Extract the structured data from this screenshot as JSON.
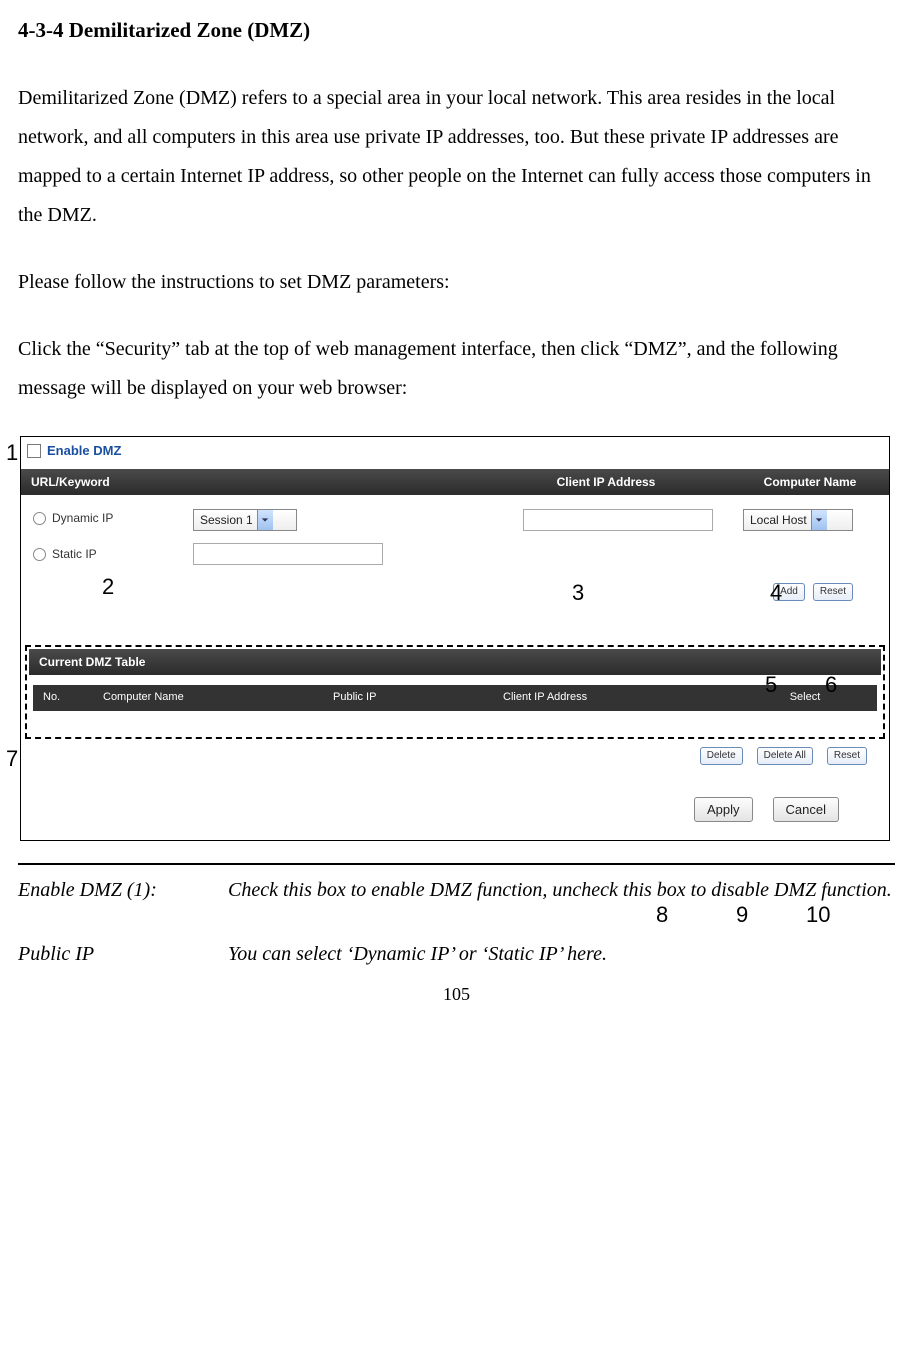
{
  "heading": "4-3-4 Demilitarized Zone (DMZ)",
  "para1": "Demilitarized Zone (DMZ) refers to a special area in your local network. This area resides in the local network, and all computers in this area use private IP addresses, too. But these private IP addresses are mapped to a certain Internet IP address, so other people on the Internet can fully access those computers in the DMZ.",
  "para2": "Please follow the instructions to set DMZ parameters:",
  "para3": "Click the “Security” tab at the top of web management interface, then click “DMZ”, and the following message will be displayed on your web browser:",
  "ui": {
    "enable_label": "Enable DMZ",
    "headers": {
      "url": "URL/Keyword",
      "clientip": "Client IP Address",
      "compname": "Computer Name"
    },
    "radios": {
      "dynamic": "Dynamic IP",
      "static": "Static IP"
    },
    "session_select": "Session 1",
    "local_host_select": "Local Host",
    "buttons": {
      "add": "Add",
      "reset_top": "Reset",
      "delete": "Delete",
      "delete_all": "Delete All",
      "reset_bottom": "Reset",
      "apply": "Apply",
      "cancel": "Cancel"
    },
    "current_table_title": "Current DMZ Table",
    "table_headers": {
      "no": "No.",
      "cn": "Computer Name",
      "pip": "Public IP",
      "clip": "Client IP Address",
      "sel": "Select"
    }
  },
  "callouts": {
    "c1": "1",
    "c2": "2",
    "c3": "3",
    "c4": "4",
    "c5": "5",
    "c6": "6",
    "c7": "7",
    "c8": "8",
    "c9": "9",
    "c10": "10"
  },
  "defs": {
    "term1": "Enable DMZ (1):",
    "desc1": "Check this box to enable DMZ function, uncheck this box to disable DMZ function.",
    "term2": "Public IP",
    "desc2": "You can select ‘Dynamic IP’ or ‘Static IP’ here."
  },
  "page_number": "105"
}
